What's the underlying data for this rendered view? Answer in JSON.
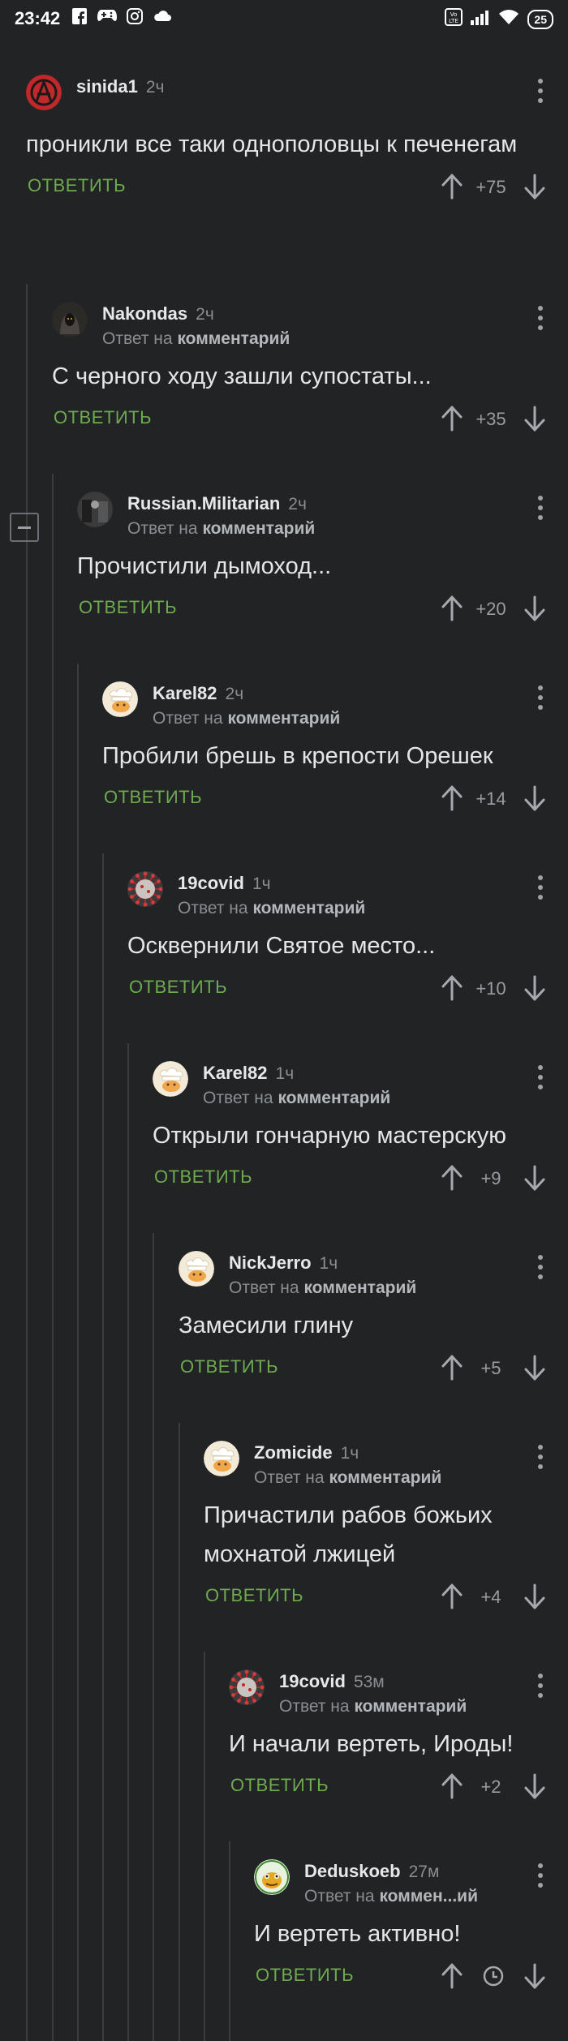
{
  "status_bar": {
    "time": "23:42",
    "left_icons": [
      "facebook-icon",
      "gamepad-icon",
      "instagram-icon",
      "cloud-icon"
    ],
    "right_icons": [
      "volte-icon",
      "signal-icon",
      "wifi-icon"
    ],
    "battery": "25"
  },
  "labels": {
    "reply": "ОТВЕТИТЬ",
    "reply_to_prefix": "Ответ на",
    "reply_to_target": "комментарий"
  },
  "colors": {
    "background": "#212325",
    "reply_green": "#6eaa50",
    "muted": "#8a8e92"
  },
  "comments": [
    {
      "user": "sinida1",
      "time": "2ч",
      "reply_to": false,
      "text": "проникли все таки однополовцы к печенегам",
      "score": "+75",
      "avatar": "anarchy-icon"
    },
    {
      "user": "Nakondas",
      "time": "2ч",
      "reply_to": true,
      "text": "С черного ходу зашли супостаты...",
      "score": "+35",
      "avatar": "hooded-figure-avatar"
    },
    {
      "user": "Russian.Militarian",
      "time": "2ч",
      "reply_to": true,
      "text": "Прочистили дымоход...",
      "score": "+20",
      "avatar": "soldier-avatar"
    },
    {
      "user": "Karel82",
      "time": "2ч",
      "reply_to": true,
      "text": "Пробили брешь в крепости Орешек",
      "score": "+14",
      "avatar": "chef-avatar"
    },
    {
      "user": "19covid",
      "time": "1ч",
      "reply_to": true,
      "text": "Осквернили Святое место...",
      "score": "+10",
      "avatar": "virus-avatar"
    },
    {
      "user": "Karel82",
      "time": "1ч",
      "reply_to": true,
      "text": "Открыли гончарную мастерскую",
      "score": "+9",
      "avatar": "chef-avatar"
    },
    {
      "user": "NickJerro",
      "time": "1ч",
      "reply_to": true,
      "text": "Замесили глину",
      "score": "+5",
      "avatar": "chef-avatar"
    },
    {
      "user": "Zomicide",
      "time": "1ч",
      "reply_to": true,
      "text": "Причастили рабов божьих мохнатой лжицей",
      "score": "+4",
      "avatar": "chef-avatar"
    },
    {
      "user": "19covid",
      "time": "53м",
      "reply_to": true,
      "text": "И начали вертеть, Ироды!",
      "score": "+2",
      "avatar": "virus-avatar"
    },
    {
      "user": "Deduskoeb",
      "time": "27м",
      "reply_to": true,
      "reply_to_target_override": "коммен...ий",
      "text": "И вертеть активно!",
      "score": null,
      "pending_icon": "clock-icon",
      "avatar": "frog-avatar"
    }
  ]
}
